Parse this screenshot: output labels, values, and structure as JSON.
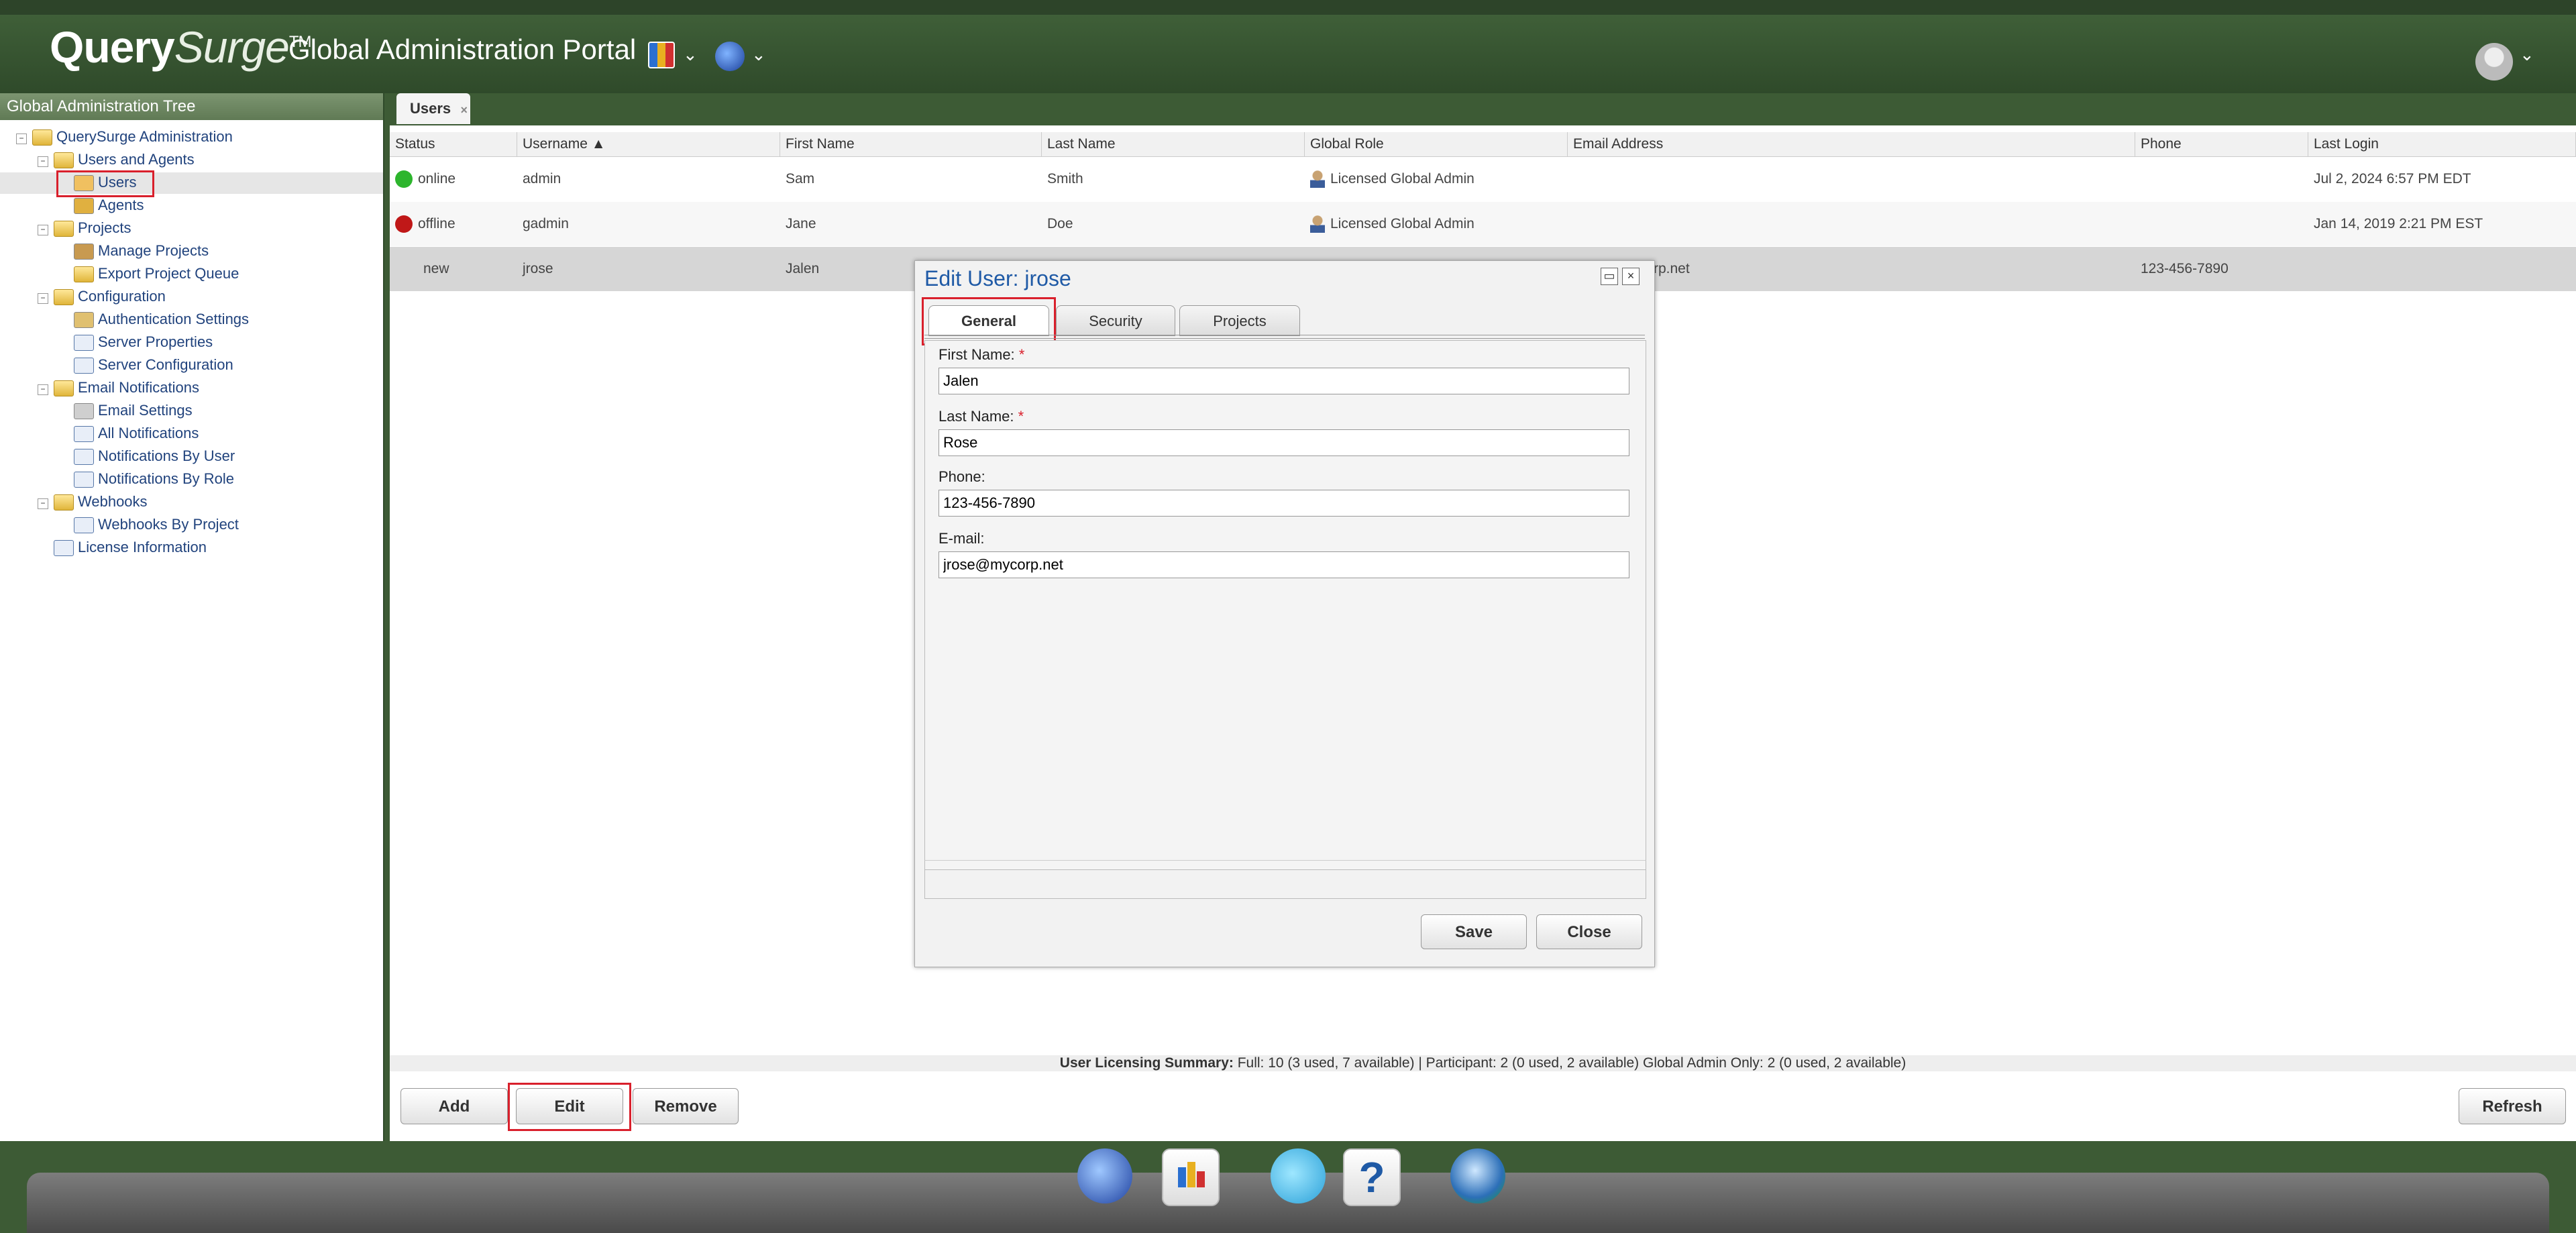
{
  "header": {
    "brand_query": "Query",
    "brand_surge": "Surge",
    "brand_tm": "TM",
    "portal_title": "Global Administration Portal"
  },
  "tree": {
    "title": "Global Administration Tree",
    "items": [
      {
        "label": "QuerySurge Administration"
      },
      {
        "label": "Users and Agents"
      },
      {
        "label": "Users"
      },
      {
        "label": "Agents"
      },
      {
        "label": "Projects"
      },
      {
        "label": "Manage Projects"
      },
      {
        "label": "Export Project Queue"
      },
      {
        "label": "Configuration"
      },
      {
        "label": "Authentication Settings"
      },
      {
        "label": "Server Properties"
      },
      {
        "label": "Server Configuration"
      },
      {
        "label": "Email Notifications"
      },
      {
        "label": "Email Settings"
      },
      {
        "label": "All Notifications"
      },
      {
        "label": "Notifications By User"
      },
      {
        "label": "Notifications By Role"
      },
      {
        "label": "Webhooks"
      },
      {
        "label": "Webhooks By Project"
      },
      {
        "label": "License Information"
      }
    ]
  },
  "tab": {
    "label": "Users",
    "close": "×"
  },
  "grid": {
    "columns": [
      "Status",
      "Username ▲",
      "First Name",
      "Last Name",
      "Global Role",
      "Email Address",
      "Phone",
      "Last Login"
    ],
    "rows": [
      {
        "status": "online",
        "status_color": "#2db52d",
        "username": "admin",
        "first": "Sam",
        "last": "Smith",
        "role": "Licensed Global Admin",
        "email": "",
        "phone": "",
        "last_login": "Jul 2, 2024 6:57 PM EDT"
      },
      {
        "status": "offline",
        "status_color": "#c01818",
        "username": "gadmin",
        "first": "Jane",
        "last": "Doe",
        "role": "Licensed Global Admin",
        "email": "",
        "phone": "",
        "last_login": "Jan 14, 2019 2:21 PM EST"
      },
      {
        "status": "new",
        "username": "jrose",
        "first": "Jalen",
        "last": "",
        "role": "",
        "email": "rp.net",
        "phone": "123-456-7890",
        "last_login": ""
      }
    ]
  },
  "summary": {
    "label": "User Licensing Summary:",
    "text": " Full: 10 (3 used, 7 available) | Participant: 2 (0 used, 2 available) Global Admin Only: 2 (0 used, 2 available)"
  },
  "buttons": {
    "add": "Add",
    "edit": "Edit",
    "remove": "Remove",
    "refresh": "Refresh"
  },
  "dialog": {
    "title": "Edit User: jrose",
    "tabs": [
      "General",
      "Security",
      "Projects"
    ],
    "fields": {
      "first_name_label": "First Name:",
      "first_name": "Jalen",
      "last_name_label": "Last Name:",
      "last_name": "Rose",
      "phone_label": "Phone:",
      "phone": "123-456-7890",
      "email_label": "E-mail:",
      "email": "jrose@mycorp.net",
      "required_mark": "*"
    },
    "save": "Save",
    "close": "Close"
  },
  "dock": {
    "icons": [
      "querysurge-icon",
      "reports-icon",
      "chat-icon",
      "help-icon",
      "globe-icon"
    ]
  }
}
